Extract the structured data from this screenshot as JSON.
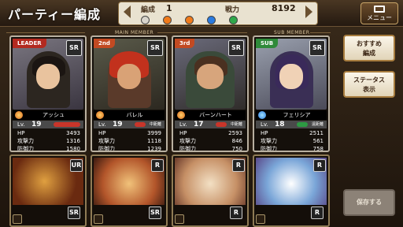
{
  "header": {
    "title": "パーティー編成",
    "party_label": "編成",
    "party_number": "1",
    "power_label": "戦力",
    "power_value": "8192",
    "menu_label": "メニュー"
  },
  "sections": {
    "main_member": "MAIN MEMBER",
    "sub_member": "SUB MEMBER"
  },
  "stat_labels": {
    "lv": "Lv.",
    "hp": "HP",
    "atk": "攻撃力",
    "def": "防御力"
  },
  "members": [
    {
      "position": "LEADER",
      "rarity": "SR",
      "name": "アッシュ",
      "lv": "19",
      "hp": "3493",
      "atk": "1316",
      "def": "1580",
      "bar_color": "#c8352a",
      "badge": ""
    },
    {
      "position": "2nd",
      "rarity": "SR",
      "name": "バレル",
      "lv": "19",
      "hp": "3999",
      "atk": "1118",
      "def": "1239",
      "bar_color": "#c8352a",
      "badge": "中距離"
    },
    {
      "position": "3rd",
      "rarity": "SR",
      "name": "バーンハート",
      "lv": "17",
      "hp": "2593",
      "atk": "846",
      "def": "750",
      "bar_color": "#c8352a",
      "badge": "中距離"
    },
    {
      "position": "SUB",
      "rarity": "SR",
      "name": "フェリシア",
      "lv": "18",
      "hp": "2511",
      "atk": "561",
      "def": "758",
      "bar_color": "#2d9a43",
      "badge": "遠距離"
    }
  ],
  "items": [
    {
      "rarity": "UR"
    },
    {
      "rarity": "R"
    },
    {
      "rarity": "R"
    },
    {
      "rarity": "R"
    }
  ],
  "equip_row": [
    {
      "rarity": "SR"
    },
    {
      "rarity": "SR"
    },
    {
      "rarity": "R"
    },
    {
      "rarity": "R"
    }
  ],
  "buttons": {
    "recommend": "おすすめ\n編成",
    "status": "ステータス\n表示",
    "save": "保存する"
  },
  "element_orbs": [
    "#d8d4cc",
    "#f07a1a",
    "#f07a1a",
    "#2a7be0",
    "#2fa84a"
  ]
}
